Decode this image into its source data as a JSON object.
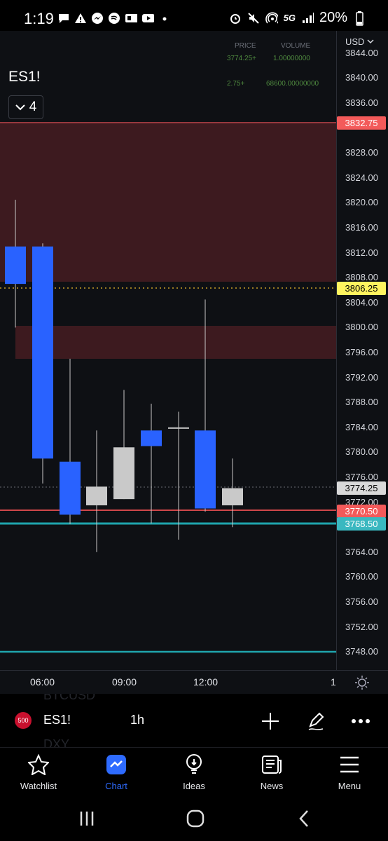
{
  "status_bar": {
    "time": "1:19",
    "battery": "20%",
    "network": "5G"
  },
  "symbol": {
    "name": "ES1!",
    "interval_count": "4",
    "interval": "1h",
    "exchange_badge": "500"
  },
  "data_panel": {
    "price_header": "PRICE",
    "volume_header": "VOLUME",
    "row1_price": "3774.25+",
    "row1_volume": "1.00000000",
    "row2_price": "2.75+",
    "row2_volume": "68600.00000000"
  },
  "currency": "USD",
  "price_axis_labels": [
    "3844.00",
    "3840.00",
    "3836.00",
    "3828.00",
    "3824.00",
    "3820.00",
    "3816.00",
    "3812.00",
    "3808.00",
    "3804.00",
    "3800.00",
    "3796.00",
    "3792.00",
    "3788.00",
    "3784.00",
    "3780.00",
    "3776.00",
    "3772.00",
    "3764.00",
    "3760.00",
    "3756.00",
    "3752.00",
    "3748.00"
  ],
  "price_tags": {
    "zone_top": "3832.75",
    "dotted_line": "3806.25",
    "last_price": "3774.25",
    "red_line": "3770.50",
    "teal_line": "3768.50"
  },
  "colors": {
    "bull": "#c9c9c9",
    "bear": "#2962ff",
    "zone": "#3d1a1f",
    "red_line": "#d0474a",
    "teal_line": "#1fa5ad",
    "dotted": "#c8a028",
    "tag_red": "#f35a5a",
    "tag_yellow": "#fff45f",
    "tag_teal": "#3ab8c0",
    "tag_grey": "#d9d9d9"
  },
  "candles": [
    {
      "time": "04:00",
      "open": 3813.0,
      "high": 3820.5,
      "low": 3800.0,
      "close": 3807.0
    },
    {
      "time": "05:00",
      "open": 3813.0,
      "high": 3813.5,
      "low": 3775.0,
      "close": 3779.0
    },
    {
      "time": "06:00",
      "open": 3778.5,
      "high": 3795.0,
      "low": 3768.5,
      "close": 3770.0
    },
    {
      "time": "07:00",
      "open": 3771.5,
      "high": 3783.5,
      "low": 3764.0,
      "close": 3774.5
    },
    {
      "time": "08:00",
      "open": 3772.5,
      "high": 3790.0,
      "low": 3772.5,
      "close": 3780.8
    },
    {
      "time": "09:00",
      "open": 3783.5,
      "high": 3787.8,
      "low": 3768.6,
      "close": 3781.0
    },
    {
      "time": "10:00",
      "open": 3783.8,
      "high": 3786.5,
      "low": 3766.0,
      "close": 3784.0
    },
    {
      "time": "11:00",
      "open": 3783.5,
      "high": 3804.5,
      "low": 3770.5,
      "close": 3771.0
    },
    {
      "time": "12:00",
      "open": 3771.5,
      "high": 3779.0,
      "low": 3768.0,
      "close": 3774.25
    }
  ],
  "time_labels": [
    "06:00",
    "09:00",
    "12:00",
    "1"
  ],
  "toolbar": {
    "watchlist": "Watchlist",
    "chart": "Chart",
    "ideas": "Ideas",
    "news": "News",
    "menu": "Menu"
  },
  "ghost_text": {
    "top": "BTCUSD",
    "bottom": "DXY"
  }
}
